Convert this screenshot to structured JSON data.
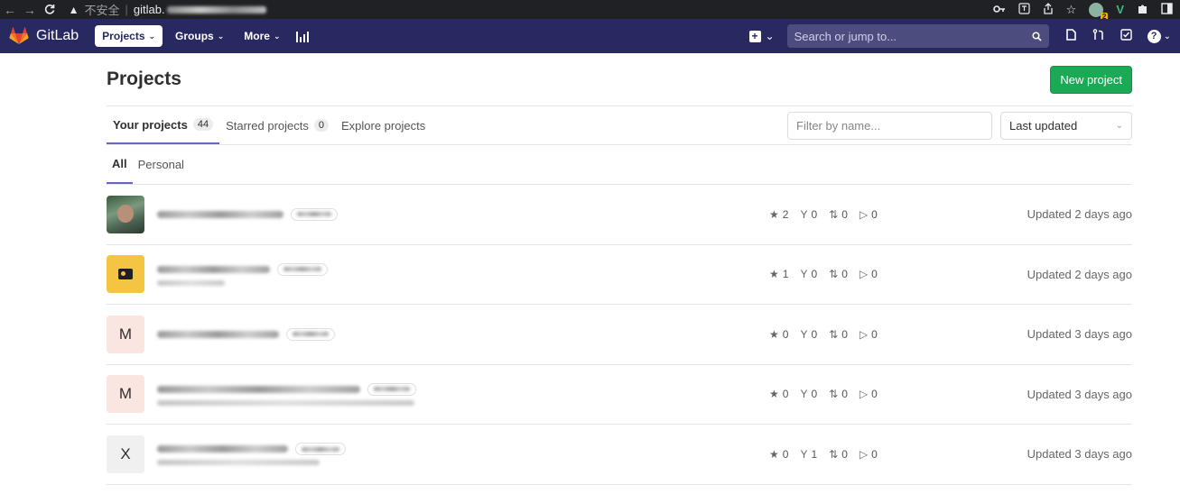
{
  "browser": {
    "back": "←",
    "forward": "→",
    "reload": "C",
    "warning_icon": "▲",
    "insecure_label": "不安全",
    "separator": "|",
    "host": "gitlab.",
    "ext_badge_count": "2"
  },
  "topnav": {
    "brand": "GitLab",
    "projects_label": "Projects",
    "groups_label": "Groups",
    "more_label": "More",
    "search_placeholder": "Search or jump to...",
    "help_label": "?"
  },
  "page": {
    "title": "Projects",
    "new_project_label": "New project"
  },
  "tabs": [
    {
      "label": "Your projects",
      "count": "44"
    },
    {
      "label": "Starred projects",
      "count": "0"
    },
    {
      "label": "Explore projects",
      "count": ""
    }
  ],
  "filter": {
    "placeholder": "Filter by name...",
    "sort_value": "Last updated"
  },
  "subtabs": [
    {
      "label": "All"
    },
    {
      "label": "Personal"
    }
  ],
  "projects": [
    {
      "avatar_letter": "",
      "stars": "2",
      "forks": "0",
      "mrs": "0",
      "issues": "0",
      "updated": "Updated 2 days ago"
    },
    {
      "avatar_letter": "",
      "stars": "1",
      "forks": "0",
      "mrs": "0",
      "issues": "0",
      "updated": "Updated 2 days ago"
    },
    {
      "avatar_letter": "M",
      "stars": "0",
      "forks": "0",
      "mrs": "0",
      "issues": "0",
      "updated": "Updated 3 days ago"
    },
    {
      "avatar_letter": "M",
      "stars": "0",
      "forks": "0",
      "mrs": "0",
      "issues": "0",
      "updated": "Updated 3 days ago"
    },
    {
      "avatar_letter": "X",
      "stars": "0",
      "forks": "1",
      "mrs": "0",
      "issues": "0",
      "updated": "Updated 3 days ago"
    }
  ],
  "colors": {
    "topnav_bg": "#292961",
    "primary_button": "#1aaa55",
    "active_tab_underline": "#6666c4"
  }
}
